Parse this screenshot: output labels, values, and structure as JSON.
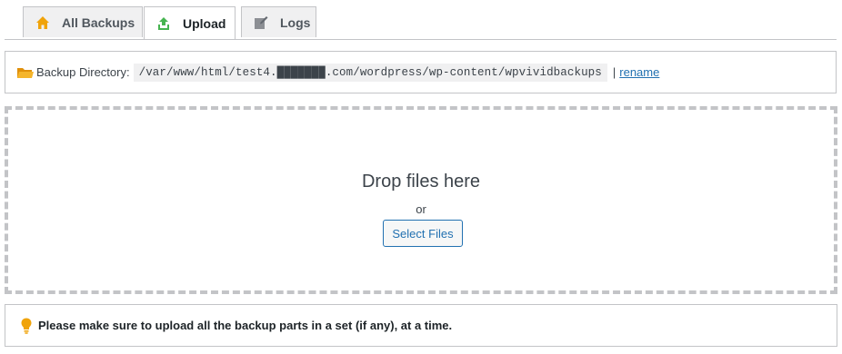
{
  "tabs": [
    {
      "label": "All Backups",
      "icon": "home-icon",
      "active": false
    },
    {
      "label": "Upload",
      "icon": "upload-icon",
      "active": true
    },
    {
      "label": "Logs",
      "icon": "edit-icon",
      "active": false
    }
  ],
  "directory": {
    "label": "Backup Directory:",
    "path": "/var/www/html/test4.███████.com/wordpress/wp-content/wpvividbackups",
    "separator": "|",
    "rename_label": "rename"
  },
  "dropzone": {
    "title": "Drop files here",
    "or_text": "or",
    "select_button": "Select Files"
  },
  "notice": {
    "text": "Please make sure to upload all the backup parts in a set (if any), at a time."
  },
  "colors": {
    "accent": "#2271b1",
    "home_icon": "#f0a30a",
    "upload_icon": "#46b450",
    "folder_icon": "#f0a30a",
    "bulb_icon": "#f0a30a",
    "border": "#c3c4c7"
  }
}
